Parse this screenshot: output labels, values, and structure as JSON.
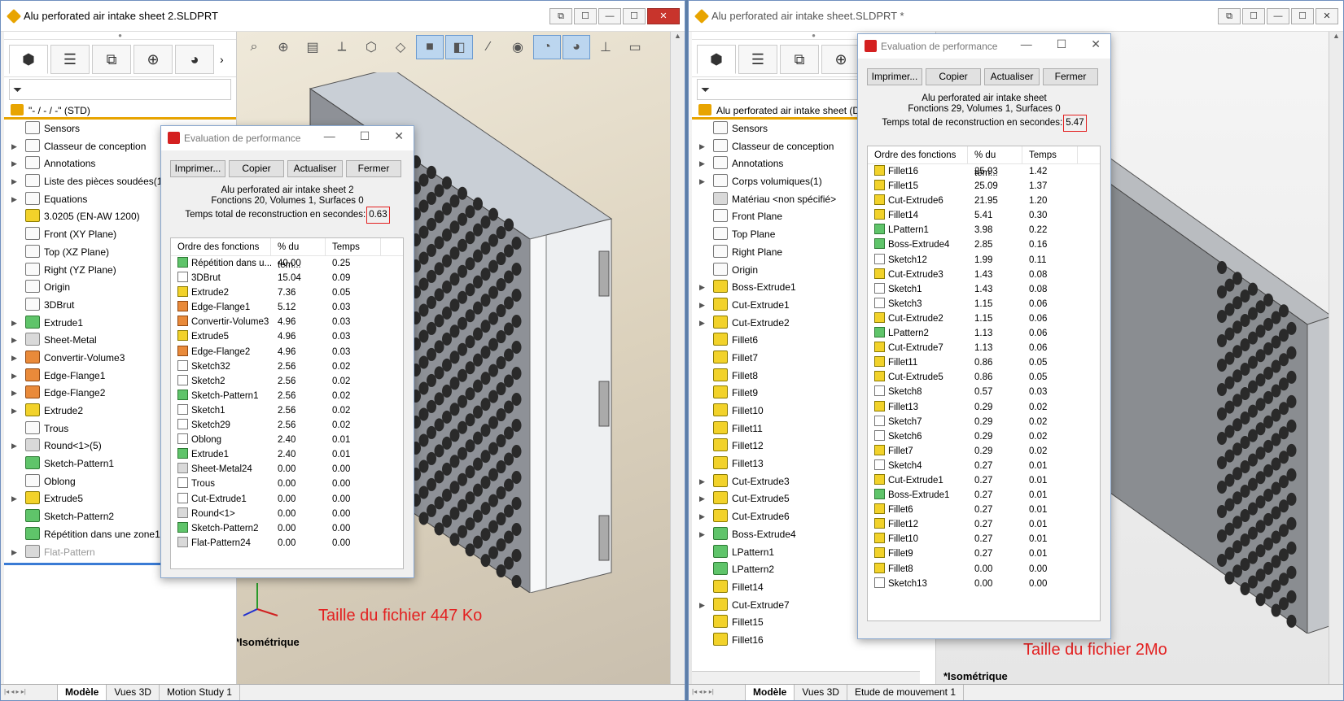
{
  "left": {
    "title": "Alu perforated air intake sheet 2.SLDPRT",
    "root_label": "\"- / - / -\"  (STD)",
    "tree": [
      {
        "label": "Sensors",
        "arrow": false,
        "icon": "sensor-icon",
        "c": ""
      },
      {
        "label": "Classeur de conception",
        "arrow": true,
        "icon": "folder-icon",
        "c": ""
      },
      {
        "label": "Annotations",
        "arrow": true,
        "icon": "annotation-icon",
        "c": ""
      },
      {
        "label": "Liste des pièces soudées(1)",
        "arrow": true,
        "icon": "cutlist-icon",
        "c": ""
      },
      {
        "label": "Equations",
        "arrow": true,
        "icon": "equation-icon",
        "c": ""
      },
      {
        "label": "3.0205 (EN-AW 1200)",
        "arrow": false,
        "icon": "material-icon",
        "c": "yel"
      },
      {
        "label": "Front (XY Plane)",
        "arrow": false,
        "icon": "plane-icon",
        "c": ""
      },
      {
        "label": "Top (XZ Plane)",
        "arrow": false,
        "icon": "plane-icon",
        "c": ""
      },
      {
        "label": "Right (YZ Plane)",
        "arrow": false,
        "icon": "plane-icon",
        "c": ""
      },
      {
        "label": "Origin",
        "arrow": false,
        "icon": "origin-icon",
        "c": ""
      },
      {
        "label": "3DBrut",
        "arrow": false,
        "icon": "sketch3d-icon",
        "c": ""
      },
      {
        "label": "Extrude1",
        "arrow": true,
        "icon": "extrude-icon",
        "c": "grn"
      },
      {
        "label": "Sheet-Metal",
        "arrow": true,
        "icon": "sheet-metal-icon",
        "c": "gry"
      },
      {
        "label": "Convertir-Volume3",
        "arrow": true,
        "icon": "convert-icon",
        "c": "org"
      },
      {
        "label": "Edge-Flange1",
        "arrow": true,
        "icon": "edge-flange-icon",
        "c": "org"
      },
      {
        "label": "Edge-Flange2",
        "arrow": true,
        "icon": "edge-flange-icon",
        "c": "org"
      },
      {
        "label": "Extrude2",
        "arrow": true,
        "icon": "extrude-icon",
        "c": "yel"
      },
      {
        "label": "Trous",
        "arrow": false,
        "icon": "sketch-icon",
        "c": ""
      },
      {
        "label": "Round<1>(5)",
        "arrow": true,
        "icon": "round-icon",
        "c": "gry"
      },
      {
        "label": "Sketch-Pattern1",
        "arrow": false,
        "icon": "pattern-icon",
        "c": "grn"
      },
      {
        "label": "Oblong",
        "arrow": false,
        "icon": "sketch-icon",
        "c": ""
      },
      {
        "label": "Extrude5",
        "arrow": true,
        "icon": "extrude-icon",
        "c": "yel"
      },
      {
        "label": "Sketch-Pattern2",
        "arrow": false,
        "icon": "pattern-icon",
        "c": "grn"
      },
      {
        "label": "Répétition dans une zone1",
        "arrow": false,
        "icon": "fill-pattern-icon",
        "c": "grn"
      },
      {
        "label": "Flat-Pattern",
        "arrow": true,
        "icon": "flat-pattern-icon",
        "c": "gry",
        "dim": true
      }
    ],
    "bottom_tabs": [
      "Modèle",
      "Vues 3D",
      "Motion Study 1"
    ],
    "view_label": "*Isométrique",
    "size_label": "Taille du fichier 447 Ko",
    "dialog": {
      "title": "Evaluation de performance",
      "buttons": [
        "Imprimer...",
        "Copier",
        "Actualiser",
        "Fermer"
      ],
      "doc_name": "Alu perforated air intake sheet 2",
      "counts": "Fonctions 20, Volumes 1, Surfaces 0",
      "total_label": "Temps total de reconstruction en secondes:",
      "total_value": "0.63",
      "headers": [
        "Ordre des fonctions",
        "% du tem...",
        "Temps"
      ],
      "rows": [
        [
          "Répétition dans u...",
          "40.00",
          "0.25",
          "grn"
        ],
        [
          "3DBrut",
          "15.04",
          "0.09",
          ""
        ],
        [
          "Extrude2",
          "7.36",
          "0.05",
          "yel"
        ],
        [
          "Edge-Flange1",
          "5.12",
          "0.03",
          "org"
        ],
        [
          "Convertir-Volume3",
          "4.96",
          "0.03",
          "org"
        ],
        [
          "Extrude5",
          "4.96",
          "0.03",
          "yel"
        ],
        [
          "Edge-Flange2",
          "4.96",
          "0.03",
          "org"
        ],
        [
          "Sketch32",
          "2.56",
          "0.02",
          ""
        ],
        [
          "Sketch2",
          "2.56",
          "0.02",
          ""
        ],
        [
          "Sketch-Pattern1",
          "2.56",
          "0.02",
          "grn"
        ],
        [
          "Sketch1",
          "2.56",
          "0.02",
          ""
        ],
        [
          "Sketch29",
          "2.56",
          "0.02",
          ""
        ],
        [
          "Oblong",
          "2.40",
          "0.01",
          ""
        ],
        [
          "Extrude1",
          "2.40",
          "0.01",
          "grn"
        ],
        [
          "Sheet-Metal24",
          "0.00",
          "0.00",
          "gry"
        ],
        [
          "Trous",
          "0.00",
          "0.00",
          ""
        ],
        [
          "Cut-Extrude1",
          "0.00",
          "0.00",
          ""
        ],
        [
          "Round<1>",
          "0.00",
          "0.00",
          "gry"
        ],
        [
          "Sketch-Pattern2",
          "0.00",
          "0.00",
          "grn"
        ],
        [
          "Flat-Pattern24",
          "0.00",
          "0.00",
          "gry"
        ]
      ]
    }
  },
  "right": {
    "title": "Alu perforated air intake sheet.SLDPRT *",
    "root_label": "Alu perforated air intake sheet  (D",
    "tree": [
      {
        "label": "Sensors",
        "arrow": false,
        "c": ""
      },
      {
        "label": "Classeur de conception",
        "arrow": true,
        "c": ""
      },
      {
        "label": "Annotations",
        "arrow": true,
        "c": ""
      },
      {
        "label": "Corps volumiques(1)",
        "arrow": true,
        "c": ""
      },
      {
        "label": "Matériau <non spécifié>",
        "arrow": false,
        "c": "gry"
      },
      {
        "label": "Front Plane",
        "arrow": false,
        "c": ""
      },
      {
        "label": "Top Plane",
        "arrow": false,
        "c": ""
      },
      {
        "label": "Right Plane",
        "arrow": false,
        "c": ""
      },
      {
        "label": "Origin",
        "arrow": false,
        "c": ""
      },
      {
        "label": "Boss-Extrude1",
        "arrow": true,
        "c": "yel"
      },
      {
        "label": "Cut-Extrude1",
        "arrow": true,
        "c": "yel"
      },
      {
        "label": "Cut-Extrude2",
        "arrow": true,
        "c": "yel"
      },
      {
        "label": "Fillet6",
        "arrow": false,
        "c": "yel"
      },
      {
        "label": "Fillet7",
        "arrow": false,
        "c": "yel"
      },
      {
        "label": "Fillet8",
        "arrow": false,
        "c": "yel"
      },
      {
        "label": "Fillet9",
        "arrow": false,
        "c": "yel"
      },
      {
        "label": "Fillet10",
        "arrow": false,
        "c": "yel"
      },
      {
        "label": "Fillet11",
        "arrow": false,
        "c": "yel"
      },
      {
        "label": "Fillet12",
        "arrow": false,
        "c": "yel"
      },
      {
        "label": "Fillet13",
        "arrow": false,
        "c": "yel"
      },
      {
        "label": "Cut-Extrude3",
        "arrow": true,
        "c": "yel"
      },
      {
        "label": "Cut-Extrude5",
        "arrow": true,
        "c": "yel"
      },
      {
        "label": "Cut-Extrude6",
        "arrow": true,
        "c": "yel"
      },
      {
        "label": "Boss-Extrude4",
        "arrow": true,
        "c": "grn"
      },
      {
        "label": "LPattern1",
        "arrow": false,
        "c": "grn"
      },
      {
        "label": "LPattern2",
        "arrow": false,
        "c": "grn"
      },
      {
        "label": "Fillet14",
        "arrow": false,
        "c": "yel"
      },
      {
        "label": "Cut-Extrude7",
        "arrow": true,
        "c": "yel"
      },
      {
        "label": "Fillet15",
        "arrow": false,
        "c": "yel"
      },
      {
        "label": "Fillet16",
        "arrow": false,
        "c": "yel"
      }
    ],
    "bottom_tabs": [
      "Modèle",
      "Vues 3D",
      "Etude de mouvement 1"
    ],
    "view_label": "*Isométrique",
    "size_label": "Taille du fichier 2Mo",
    "dialog": {
      "title": "Evaluation de performance",
      "buttons": [
        "Imprimer...",
        "Copier",
        "Actualiser",
        "Fermer"
      ],
      "doc_name": "Alu perforated air intake sheet",
      "counts": "Fonctions 29, Volumes 1, Surfaces 0",
      "total_label": "Temps total de reconstruction en secondes:",
      "total_value": "5.47",
      "headers": [
        "Ordre des fonctions",
        "% du tem...",
        "Temps"
      ],
      "rows": [
        [
          "Fillet16",
          "25.93",
          "1.42",
          "yel"
        ],
        [
          "Fillet15",
          "25.09",
          "1.37",
          "yel"
        ],
        [
          "Cut-Extrude6",
          "21.95",
          "1.20",
          "yel"
        ],
        [
          "Fillet14",
          "5.41",
          "0.30",
          "yel"
        ],
        [
          "LPattern1",
          "3.98",
          "0.22",
          "grn"
        ],
        [
          "Boss-Extrude4",
          "2.85",
          "0.16",
          "grn"
        ],
        [
          "Sketch12",
          "1.99",
          "0.11",
          ""
        ],
        [
          "Cut-Extrude3",
          "1.43",
          "0.08",
          "yel"
        ],
        [
          "Sketch1",
          "1.43",
          "0.08",
          ""
        ],
        [
          "Sketch3",
          "1.15",
          "0.06",
          ""
        ],
        [
          "Cut-Extrude2",
          "1.15",
          "0.06",
          "yel"
        ],
        [
          "LPattern2",
          "1.13",
          "0.06",
          "grn"
        ],
        [
          "Cut-Extrude7",
          "1.13",
          "0.06",
          "yel"
        ],
        [
          "Fillet11",
          "0.86",
          "0.05",
          "yel"
        ],
        [
          "Cut-Extrude5",
          "0.86",
          "0.05",
          "yel"
        ],
        [
          "Sketch8",
          "0.57",
          "0.03",
          ""
        ],
        [
          "Fillet13",
          "0.29",
          "0.02",
          "yel"
        ],
        [
          "Sketch7",
          "0.29",
          "0.02",
          ""
        ],
        [
          "Sketch6",
          "0.29",
          "0.02",
          ""
        ],
        [
          "Fillet7",
          "0.29",
          "0.02",
          "yel"
        ],
        [
          "Sketch4",
          "0.27",
          "0.01",
          ""
        ],
        [
          "Cut-Extrude1",
          "0.27",
          "0.01",
          "yel"
        ],
        [
          "Boss-Extrude1",
          "0.27",
          "0.01",
          "grn"
        ],
        [
          "Fillet6",
          "0.27",
          "0.01",
          "yel"
        ],
        [
          "Fillet12",
          "0.27",
          "0.01",
          "yel"
        ],
        [
          "Fillet10",
          "0.27",
          "0.01",
          "yel"
        ],
        [
          "Fillet9",
          "0.27",
          "0.01",
          "yel"
        ],
        [
          "Fillet8",
          "0.00",
          "0.00",
          "yel"
        ],
        [
          "Sketch13",
          "0.00",
          "0.00",
          ""
        ]
      ]
    }
  },
  "window_buttons": {
    "min": "—",
    "max": "☐",
    "close": "✕",
    "restore": "⧉"
  },
  "colors": {
    "highlight": "#e32020",
    "accent": "#e8a400",
    "tree_bar": "#3a7bd5"
  }
}
